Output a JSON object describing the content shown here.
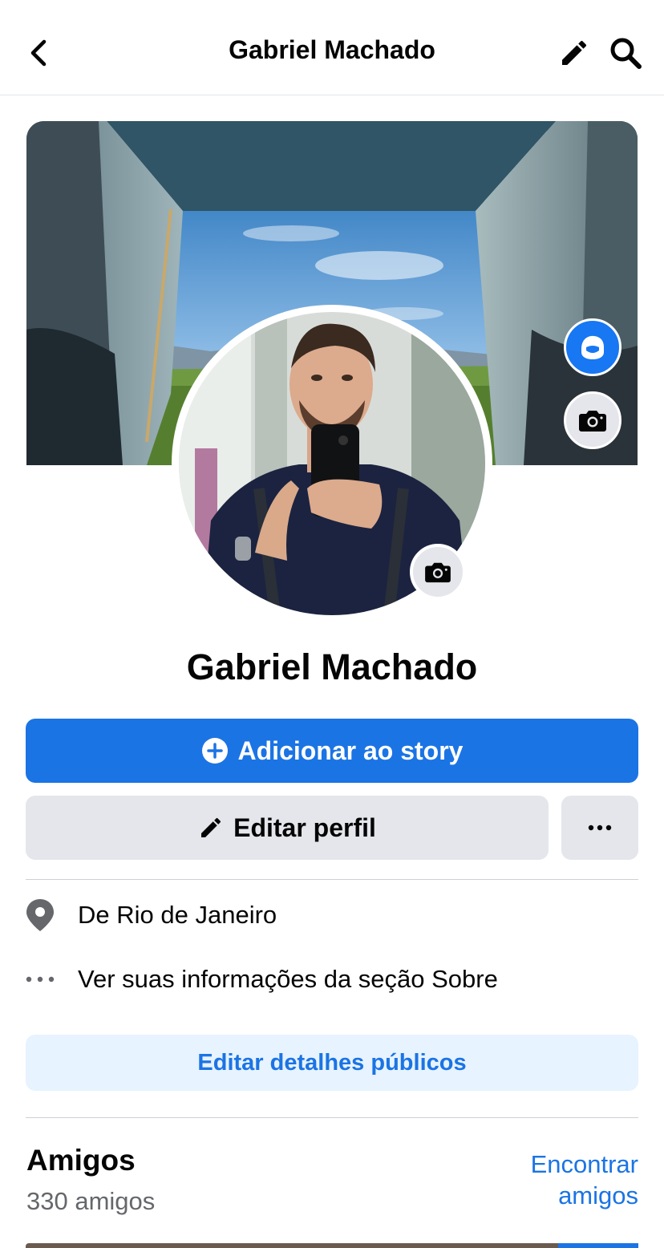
{
  "header": {
    "title": "Gabriel Machado",
    "back_icon": "chevron-left-icon",
    "edit_icon": "pencil-icon",
    "search_icon": "search-icon"
  },
  "cover": {
    "avatar_button_icon": "avatar-icon",
    "camera_button_icon": "camera-icon"
  },
  "profile": {
    "name": "Gabriel Machado",
    "camera_button_icon": "camera-icon"
  },
  "actions": {
    "add_story_label": "Adicionar ao story",
    "add_story_icon": "plus-circle-icon",
    "edit_profile_label": "Editar perfil",
    "edit_profile_icon": "pencil-icon",
    "more_icon": "ellipsis-icon"
  },
  "details": {
    "location_prefix": "De",
    "location_city": "Rio de Janeiro",
    "about_text": "Ver suas informações da seção Sobre",
    "edit_public_details_label": "Editar detalhes públicos"
  },
  "friends": {
    "title": "Amigos",
    "count_text": "330 amigos",
    "find_friends_line1": "Encontrar",
    "find_friends_line2": "amigos"
  },
  "colors": {
    "primary_blue": "#1b74e4",
    "light_blue_bg": "#e7f3ff",
    "gray_button": "#e4e6eb",
    "secondary_text": "#65676b"
  }
}
